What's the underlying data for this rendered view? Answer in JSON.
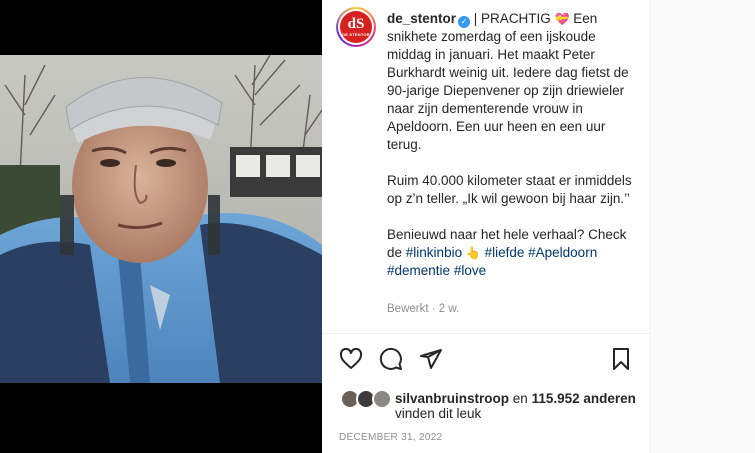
{
  "post": {
    "username": "de_stentor",
    "avatar_text": "dS",
    "avatar_subtext": "DE STENTOR",
    "caption_lines": [
      "| PRACHTIG",
      "Een snikhete zomerdag of een ijskoude middag in januari. Het maakt Peter Burkhardt weinig uit. Iedere dag fietst de 90-jarige Diepenvener op zijn driewieler naar zijn dementerende vrouw in Apeldoorn. Een uur heen en een uur terug.",
      "Ruim 40.000 kilometer staat er inmiddels op z’n teller. „Ik wil gewoon bij haar zijn.’’",
      "Benieuwd naar het hele verhaal? Check de"
    ],
    "hashtags": [
      "#linkinbio",
      "#liefde",
      "#Apeldoorn",
      "#dementie",
      "#love"
    ],
    "meta": "Bewerkt · 2 w.",
    "likes": {
      "user": "silvanbruinstroop",
      "connector": "en",
      "count": "115.952 anderen",
      "suffix": "vinden dit leuk"
    },
    "date": "DECEMBER 31, 2022"
  },
  "icons": {
    "like": "heart-icon",
    "comment": "comment-icon",
    "share": "share-icon",
    "save": "bookmark-icon",
    "verified": "verified-badge-icon"
  },
  "colors": {
    "brand_red": "#d6211f",
    "link": "#00376b",
    "muted": "#8e8e8e",
    "verified": "#3897f0"
  }
}
